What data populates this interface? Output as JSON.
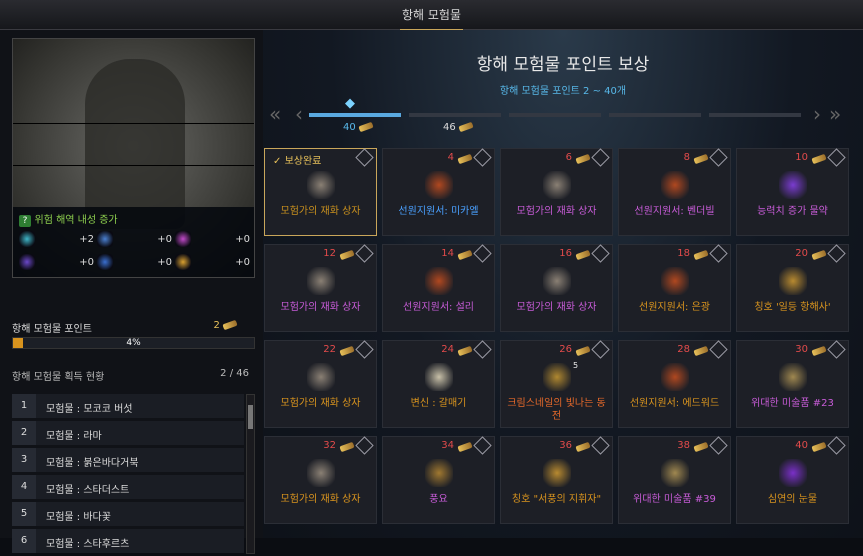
{
  "window": {
    "title": "항해 모험물"
  },
  "left": {
    "description": "위험 해역 내성 증가",
    "stats": [
      {
        "icon": "cyan-swirl-icon",
        "value": "+2",
        "color": "#3fb6c8"
      },
      {
        "icon": "blue-wave-icon",
        "value": "+0",
        "color": "#4a7fd0"
      },
      {
        "icon": "pink-spark-icon",
        "value": "+0",
        "color": "#c04ac8"
      },
      {
        "icon": "purple-vortex-icon",
        "value": "+0",
        "color": "#6a48c8"
      },
      {
        "icon": "blue-shard-icon",
        "value": "+0",
        "color": "#3a6fd0"
      },
      {
        "icon": "golden-sun-icon",
        "value": "+0",
        "color": "#d9a030"
      }
    ],
    "points": {
      "label": "항해 모험물 포인트",
      "value": "2",
      "progress_text": "4%",
      "progress": 4
    },
    "acquire": {
      "label": "항해 모험물 획득 현황",
      "count": "2   /   46",
      "items": [
        {
          "n": "1",
          "text": "모험물 : 모코코 버섯"
        },
        {
          "n": "2",
          "text": "모험물 : 라마"
        },
        {
          "n": "3",
          "text": "모험물 : 붉은바다거북"
        },
        {
          "n": "4",
          "text": "모험물 : 스타더스트"
        },
        {
          "n": "5",
          "text": "모험물 : 바다꽃"
        },
        {
          "n": "6",
          "text": "모험물 : 스타후르츠"
        }
      ]
    }
  },
  "main": {
    "title": "항해 모험물 포인트 보상",
    "subtitle": "항해 모험물 포인트 2 ~ 40개",
    "progress_labels": [
      "40",
      "46"
    ],
    "rewards": [
      {
        "points": "",
        "done": "보상완료",
        "name": "모험가의 재화 상자",
        "color": "#c8901e",
        "icon": "treasure-box-icon",
        "ic": "#8a8074"
      },
      {
        "points": "4",
        "name": "선원지원서: 미카엘",
        "color": "#4aa0ff",
        "icon": "scroll-icon",
        "ic": "#b04820"
      },
      {
        "points": "6",
        "name": "모험가의 재화 상자",
        "color": "#c85cd8",
        "icon": "treasure-box-icon",
        "ic": "#8a8074"
      },
      {
        "points": "8",
        "name": "선원지원서: 벤더빌",
        "color": "#c85cd8",
        "icon": "scroll-icon",
        "ic": "#b04820"
      },
      {
        "points": "10",
        "name": "능력치 증가 물약",
        "color": "#c85cd8",
        "icon": "potion-icon",
        "ic": "#7a3cd0"
      },
      {
        "points": "12",
        "name": "모험가의 재화 상자",
        "color": "#c85cd8",
        "icon": "treasure-box-icon",
        "ic": "#8a8074"
      },
      {
        "points": "14",
        "name": "선원지원서: 설리",
        "color": "#c85cd8",
        "icon": "scroll-icon",
        "ic": "#b04820"
      },
      {
        "points": "16",
        "name": "모험가의 재화 상자",
        "color": "#c85cd8",
        "icon": "treasure-box-icon",
        "ic": "#8a8074"
      },
      {
        "points": "18",
        "name": "선원지원서: 은광",
        "color": "#d9941e",
        "icon": "scroll-icon",
        "ic": "#b04820"
      },
      {
        "points": "20",
        "name": "칭호 '일등 항해사'",
        "color": "#d9941e",
        "icon": "telescope-icon",
        "ic": "#b88a30"
      },
      {
        "points": "22",
        "name": "모험가의 재화 상자",
        "color": "#d9941e",
        "icon": "treasure-box-icon",
        "ic": "#8a8074"
      },
      {
        "points": "24",
        "name": "변신 : 갈매기",
        "color": "#d9941e",
        "icon": "seagull-icon",
        "ic": "#c8c0a8"
      },
      {
        "points": "26",
        "name": "크림스네일의 빛나는 동전",
        "color": "#e86a2a",
        "icon": "coin-icon",
        "ic": "#b08830",
        "count": "5"
      },
      {
        "points": "28",
        "name": "선원지원서: 에드워드",
        "color": "#d9941e",
        "icon": "scroll-icon",
        "ic": "#b04820"
      },
      {
        "points": "30",
        "name": "위대한 미술품 #23",
        "color": "#c85cd8",
        "icon": "painting-icon",
        "ic": "#a08850"
      },
      {
        "points": "32",
        "name": "모험가의 재화 상자",
        "color": "#d9941e",
        "icon": "treasure-box-icon",
        "ic": "#8a8074"
      },
      {
        "points": "34",
        "name": "풍요",
        "color": "#c85cd8",
        "icon": "horn-icon",
        "ic": "#a07830"
      },
      {
        "points": "36",
        "name": "칭호 \"서풍의 지휘자\"",
        "color": "#d9941e",
        "icon": "telescope-icon",
        "ic": "#b88a30"
      },
      {
        "points": "38",
        "name": "위대한 미술품 #39",
        "color": "#c85cd8",
        "icon": "painting-icon",
        "ic": "#a08850"
      },
      {
        "points": "40",
        "name": "심연의 눈물",
        "color": "#d9941e",
        "icon": "purple-gem-icon",
        "ic": "#7a30c8"
      }
    ]
  }
}
